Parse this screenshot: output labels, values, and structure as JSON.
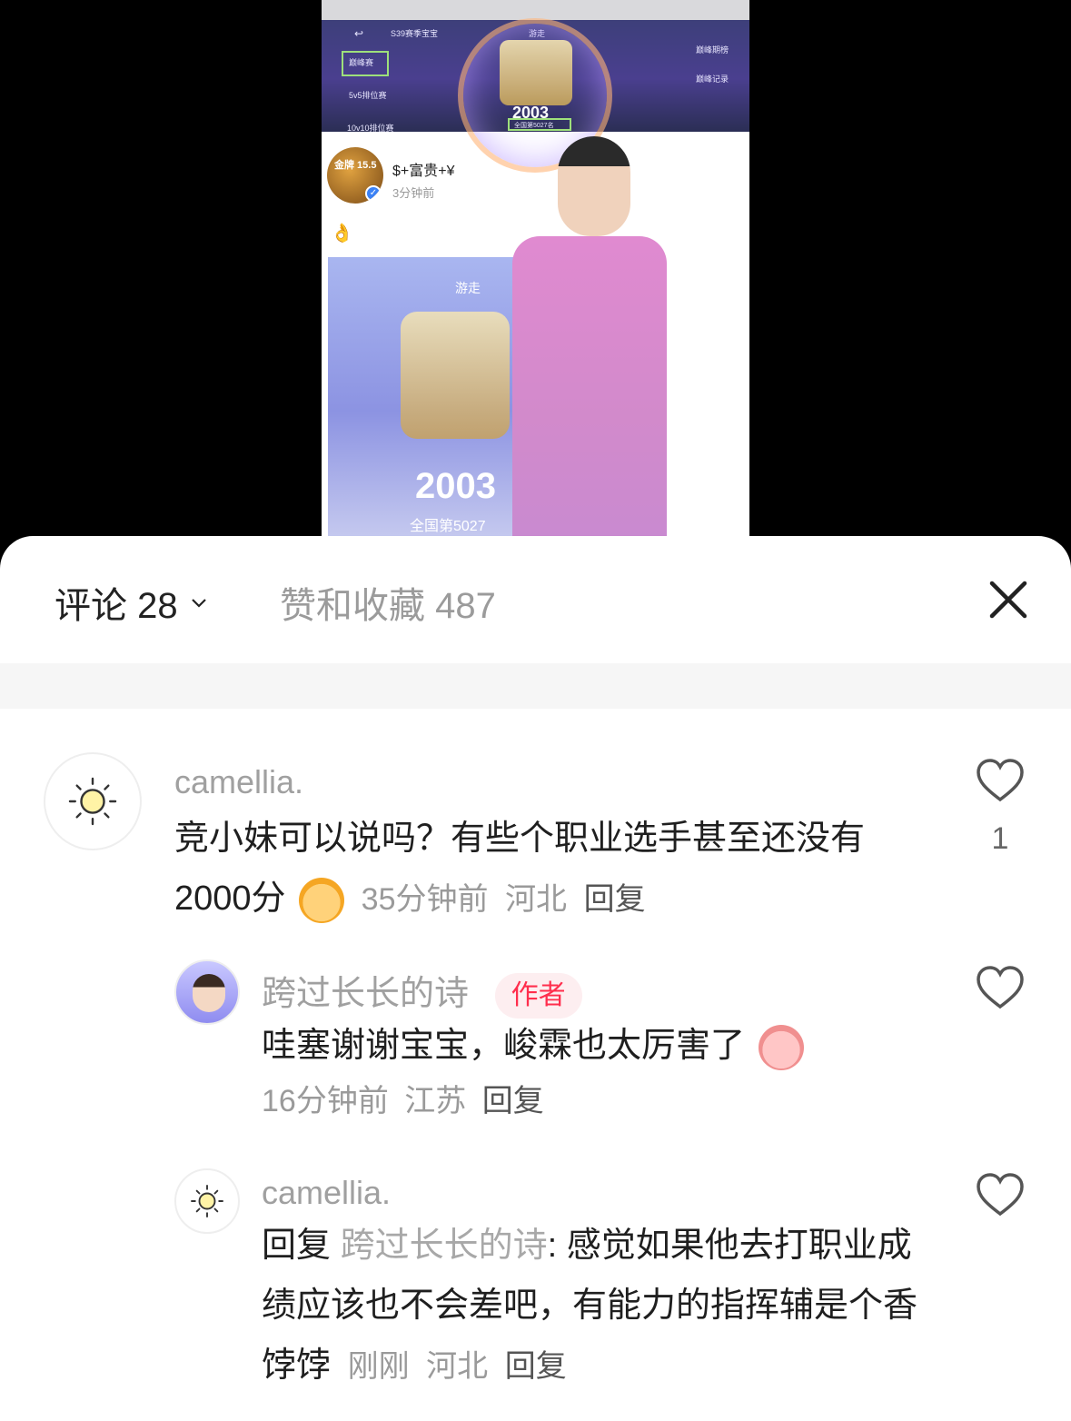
{
  "media": {
    "game": {
      "season": "S39赛季宝宝",
      "top_label": "游走",
      "rank_button": "巅峰赛",
      "modes": [
        "5v5排位赛",
        "10v10排位赛"
      ],
      "right_labels": [
        "巅峰期榜",
        "巅峰记录"
      ],
      "score": "2003",
      "nation_rank": "全国第5027名"
    },
    "post": {
      "avatar_text": "金牌 15.5",
      "user": "$+富贵+¥",
      "time": "3分钟前",
      "emoji": "👌",
      "image_label": "游走",
      "image_score": "2003",
      "image_rank": "全国第5027"
    }
  },
  "sheet": {
    "tab_comments": "评论 28",
    "tab_likes": "赞和收藏 487"
  },
  "comments": [
    {
      "user": "camellia.",
      "text": "竞小妹可以说吗？有些个职业选手甚至还没有2000分",
      "time": "35分钟前",
      "location": "河北",
      "reply": "回复",
      "likes": "1",
      "avatar_icon": "sun-icon"
    },
    {
      "user": "跨过长长的诗",
      "author_tag": "作者",
      "text": "哇塞谢谢宝宝，峻霖也太厉害了",
      "time": "16分钟前",
      "location": "江苏",
      "reply": "回复"
    },
    {
      "user": "camellia.",
      "reply_prefix": "回复",
      "mention": "跨过长长的诗",
      "text": ": 感觉如果他去打职业成绩应该也不会差吧，有能力的指挥辅是个香饽饽",
      "time": "刚刚",
      "location": "河北",
      "reply": "回复"
    }
  ],
  "colors": {
    "author_tag_bg": "#fdeef0",
    "author_tag_text": "#ff2e4d",
    "muted": "#9a9a9a"
  }
}
